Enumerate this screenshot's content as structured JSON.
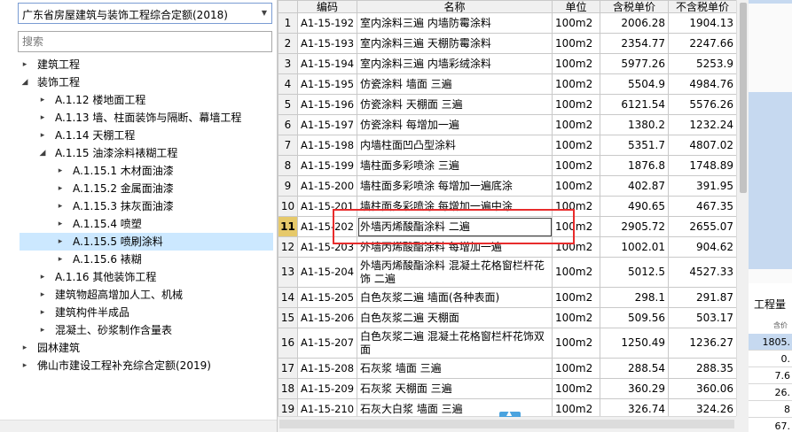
{
  "library": {
    "selected": "广东省房屋建筑与装饰工程综合定额(2018)",
    "search_placeholder": "搜索"
  },
  "tree": [
    {
      "label": "建筑工程",
      "level": 0,
      "expanded": false
    },
    {
      "label": "装饰工程",
      "level": 0,
      "expanded": true
    },
    {
      "label": "A.1.12 楼地面工程",
      "level": 1,
      "expanded": false
    },
    {
      "label": "A.1.13 墙、柱面装饰与隔断、幕墙工程",
      "level": 1,
      "expanded": false
    },
    {
      "label": "A.1.14 天棚工程",
      "level": 1,
      "expanded": false
    },
    {
      "label": "A.1.15 油漆涂料裱糊工程",
      "level": 1,
      "expanded": true
    },
    {
      "label": "A.1.15.1 木材面油漆",
      "level": 2,
      "expanded": false
    },
    {
      "label": "A.1.15.2 金属面油漆",
      "level": 2,
      "expanded": false
    },
    {
      "label": "A.1.15.3 抹灰面油漆",
      "level": 2,
      "expanded": false
    },
    {
      "label": "A.1.15.4 喷塑",
      "level": 2,
      "expanded": false
    },
    {
      "label": "A.1.15.5 喷刷涂料",
      "level": 2,
      "expanded": false,
      "selected": true
    },
    {
      "label": "A.1.15.6 裱糊",
      "level": 2,
      "expanded": false
    },
    {
      "label": "A.1.16 其他装饰工程",
      "level": 1,
      "expanded": false
    },
    {
      "label": "建筑物超高增加人工、机械",
      "level": 1,
      "expanded": false
    },
    {
      "label": "建筑构件半成品",
      "level": 1,
      "expanded": false
    },
    {
      "label": "混凝土、砂浆制作含量表",
      "level": 1,
      "expanded": false
    },
    {
      "label": "园林建筑",
      "level": 0,
      "expanded": false
    },
    {
      "label": "佛山市建设工程补充综合定额(2019)",
      "level": 0,
      "expanded": false
    }
  ],
  "grid": {
    "headers": [
      "",
      "编码",
      "名称",
      "单位",
      "含税单价",
      "不含税单价"
    ],
    "active_row": 11,
    "rows": [
      {
        "n": "1",
        "code": "A1-15-192",
        "name": "室内涂料三遍 内墙防霉涂料",
        "unit": "100m2",
        "p1": "2006.28",
        "p2": "1904.13"
      },
      {
        "n": "2",
        "code": "A1-15-193",
        "name": "室内涂料三遍 天棚防霉涂料",
        "unit": "100m2",
        "p1": "2354.77",
        "p2": "2247.66"
      },
      {
        "n": "3",
        "code": "A1-15-194",
        "name": "室内涂料三遍 内墙彩绒涂料",
        "unit": "100m2",
        "p1": "5977.26",
        "p2": "5253.9"
      },
      {
        "n": "4",
        "code": "A1-15-195",
        "name": "仿瓷涂料 墙面 三遍",
        "unit": "100m2",
        "p1": "5504.9",
        "p2": "4984.76"
      },
      {
        "n": "5",
        "code": "A1-15-196",
        "name": "仿瓷涂料 天棚面 三遍",
        "unit": "100m2",
        "p1": "6121.54",
        "p2": "5576.26"
      },
      {
        "n": "6",
        "code": "A1-15-197",
        "name": "仿瓷涂料 每增加一遍",
        "unit": "100m2",
        "p1": "1380.2",
        "p2": "1232.24"
      },
      {
        "n": "7",
        "code": "A1-15-198",
        "name": "内墙柱面凹凸型涂料",
        "unit": "100m2",
        "p1": "5351.7",
        "p2": "4807.02"
      },
      {
        "n": "8",
        "code": "A1-15-199",
        "name": "墙柱面多彩喷涂 三遍",
        "unit": "100m2",
        "p1": "1876.8",
        "p2": "1748.89"
      },
      {
        "n": "9",
        "code": "A1-15-200",
        "name": "墙柱面多彩喷涂 每增加一遍底涂",
        "unit": "100m2",
        "p1": "402.87",
        "p2": "391.95"
      },
      {
        "n": "10",
        "code": "A1-15-201",
        "name": "墙柱面多彩喷涂 每增加一遍中涂",
        "unit": "100m2",
        "p1": "490.65",
        "p2": "467.35"
      },
      {
        "n": "11",
        "code": "A1-15-202",
        "name": "外墙丙烯酸酯涂料 二遍",
        "unit": "100m2",
        "p1": "2905.72",
        "p2": "2655.07"
      },
      {
        "n": "12",
        "code": "A1-15-203",
        "name": "外墙丙烯酸酯涂料 每增加一遍",
        "unit": "100m2",
        "p1": "1002.01",
        "p2": "904.62"
      },
      {
        "n": "13",
        "code": "A1-15-204",
        "name": "外墙丙烯酸酯涂料 混凝土花格窗栏杆花饰 二遍",
        "unit": "100m2",
        "p1": "5012.5",
        "p2": "4527.33",
        "tall": true
      },
      {
        "n": "14",
        "code": "A1-15-205",
        "name": "白色灰浆二遍 墙面(各种表面)",
        "unit": "100m2",
        "p1": "298.1",
        "p2": "291.87"
      },
      {
        "n": "15",
        "code": "A1-15-206",
        "name": "白色灰浆二遍 天棚面",
        "unit": "100m2",
        "p1": "509.56",
        "p2": "503.17"
      },
      {
        "n": "16",
        "code": "A1-15-207",
        "name": "白色灰浆二遍 混凝土花格窗栏杆花饰双面",
        "unit": "100m2",
        "p1": "1250.49",
        "p2": "1236.27",
        "tall": true
      },
      {
        "n": "17",
        "code": "A1-15-208",
        "name": "石灰浆 墙面 三遍",
        "unit": "100m2",
        "p1": "288.54",
        "p2": "288.35"
      },
      {
        "n": "18",
        "code": "A1-15-209",
        "name": "石灰浆 天棚面 三遍",
        "unit": "100m2",
        "p1": "360.29",
        "p2": "360.06"
      },
      {
        "n": "19",
        "code": "A1-15-210",
        "name": "石灰大白浆 墙面 三遍",
        "unit": "100m2",
        "p1": "326.74",
        "p2": "324.26"
      }
    ]
  },
  "right_panel": {
    "header": "工程量",
    "sub": "含价",
    "cells": [
      "1805.",
      "0.",
      "7.6",
      "26.",
      "8",
      "67."
    ]
  },
  "colors": {
    "highlight_red": "#e82c2c",
    "selected_tree": "#cce8ff",
    "active_row_marker": "#e6c96a"
  }
}
